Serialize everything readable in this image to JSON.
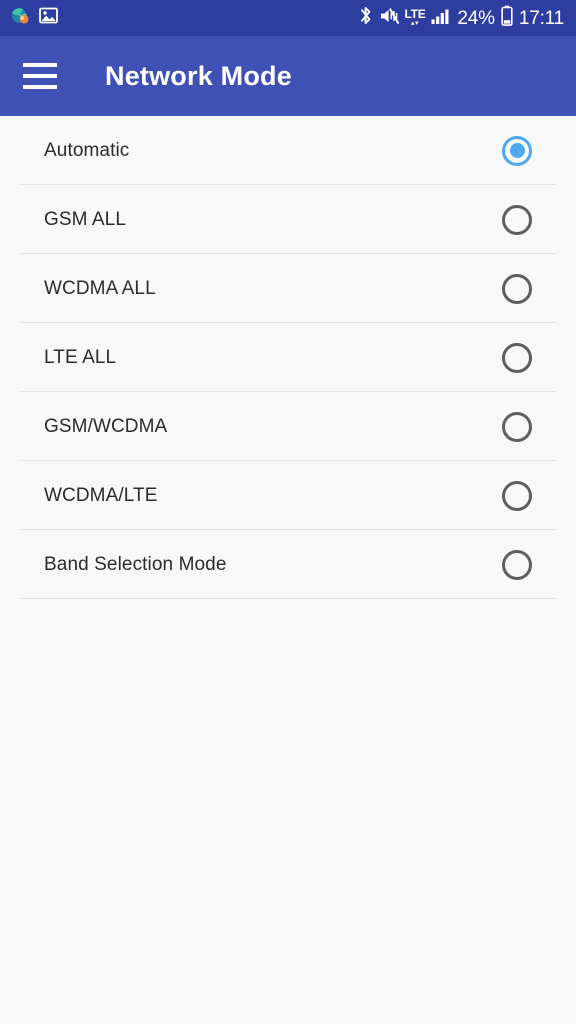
{
  "status_bar": {
    "background_color": "#2e3da0",
    "notifications": [
      {
        "icon": "globe-browser-icon",
        "name": "browser-notification"
      },
      {
        "icon": "image-photo-icon",
        "name": "screenshot-notification"
      }
    ],
    "indicators": {
      "bluetooth_icon": "bluetooth-icon",
      "sound_icon": "mute-vibrate-icon",
      "network_type": "LTE",
      "network_arrows": "▴▾",
      "signal_icon": "signal-bars-icon",
      "battery_percent": "24%",
      "battery_icon": "battery-icon",
      "clock": "17:11"
    }
  },
  "app_bar": {
    "background_color": "#3f51b5",
    "menu_icon": "hamburger-menu-icon",
    "title": "Network Mode"
  },
  "content": {
    "background_color": "#f8f8f8",
    "selected_color": "#4fa8ef",
    "unselected_color": "#5e5e5e",
    "options": [
      {
        "label": "Automatic",
        "selected": true
      },
      {
        "label": "GSM ALL",
        "selected": false
      },
      {
        "label": "WCDMA ALL",
        "selected": false
      },
      {
        "label": "LTE ALL",
        "selected": false
      },
      {
        "label": "GSM/WCDMA",
        "selected": false
      },
      {
        "label": "WCDMA/LTE",
        "selected": false
      },
      {
        "label": "Band Selection Mode",
        "selected": false
      }
    ]
  }
}
